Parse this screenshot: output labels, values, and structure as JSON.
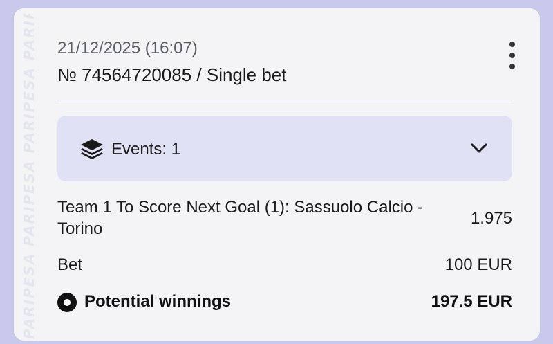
{
  "bet_card": {
    "watermark": "PARIPESA PARIPESA PARIPESA PARIPESA",
    "date": "21/12/2025 (16:07)",
    "ticket": "№ 74564720085 / Single bet",
    "menu_icon": "kebab-menu-icon",
    "events_label": "Events: 1",
    "events_icon": "layers-icon",
    "expand_icon": "chevron-down-icon",
    "event_name": "Team 1 To Score Next Goal (1): Sassuolo Calcio - Torino",
    "odds": "1.975",
    "bet_label": "Bet",
    "bet_value": "100 EUR",
    "winnings_label": "Potential winnings",
    "winnings_value": "197.5 EUR",
    "winnings_icon": "radio-dot-icon"
  },
  "colors": {
    "background": "#c9c9ec",
    "card": "#f4f4f7",
    "events_panel": "#e1e1f6"
  }
}
